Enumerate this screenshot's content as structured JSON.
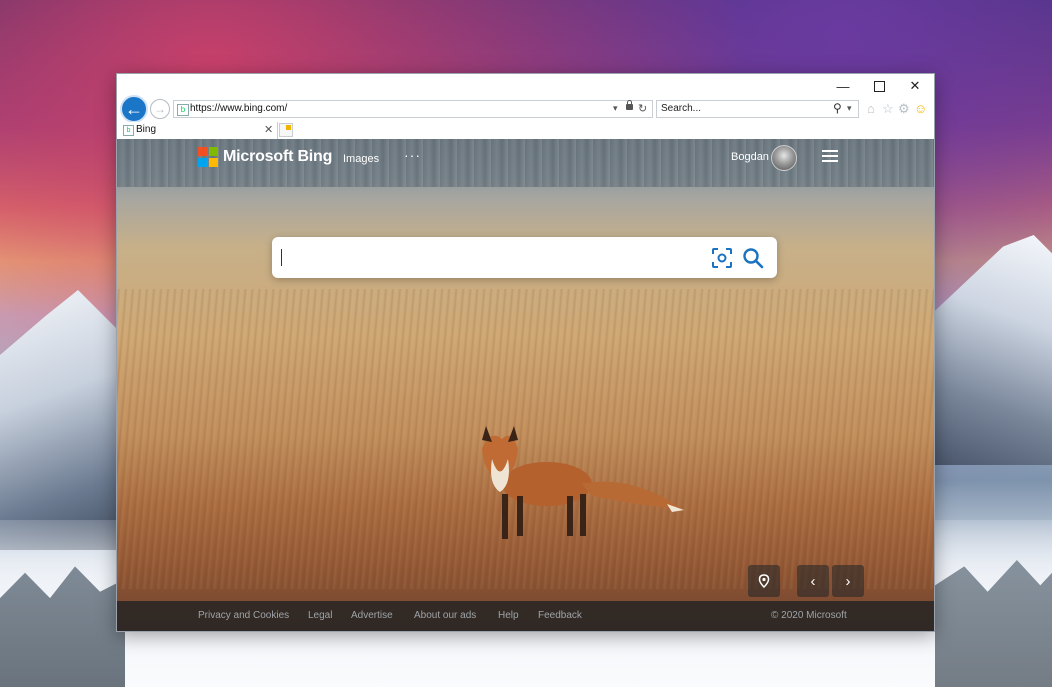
{
  "window": {
    "controls": {
      "minimize": "—",
      "maximize": "",
      "close": "✕"
    }
  },
  "navbar": {
    "back_icon": "←",
    "forward_icon": "→",
    "address_url": "https://www.bing.com/",
    "search_placeholder": "Search...",
    "toolbar_icons": [
      "home-icon",
      "star-icon",
      "gear-icon",
      "smiley-icon"
    ]
  },
  "tabs": [
    {
      "label": "Bing",
      "close": "✕"
    }
  ],
  "bing": {
    "brand": "Microsoft Bing",
    "logo_colors": [
      "#f25022",
      "#7fba00",
      "#00a4ef",
      "#ffb900"
    ],
    "nav_images": "Images",
    "nav_more": "···",
    "user_name": "Bogdan"
  },
  "image_controls": {
    "location": "location-pin-icon",
    "prev": "‹",
    "next": "›"
  },
  "footer": {
    "links": [
      "Privacy and Cookies",
      "Legal",
      "Advertise",
      "About our ads",
      "Help",
      "Feedback"
    ],
    "copyright": "© 2020 Microsoft"
  }
}
